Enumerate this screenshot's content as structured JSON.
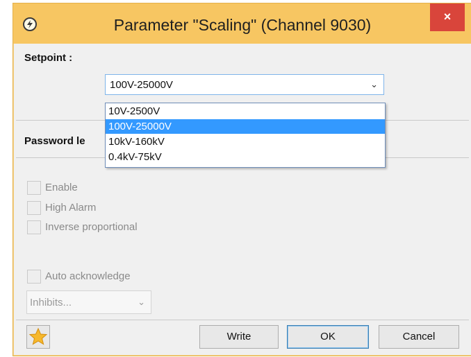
{
  "window": {
    "title": "Parameter \"Scaling\" (Channel 9030)",
    "close_glyph": "×"
  },
  "setpoint": {
    "label": "Setpoint :",
    "selected": "100V-25000V",
    "options": [
      "10V-2500V",
      "100V-25000V",
      "10kV-160kV",
      "0.4kV-75kV"
    ],
    "selected_index": 1
  },
  "password": {
    "label": "Password le"
  },
  "checkboxes": {
    "enable": "Enable",
    "high_alarm": "High Alarm",
    "inverse": "Inverse proportional",
    "auto_ack": "Auto acknowledge"
  },
  "inhibits": {
    "value": "Inhibits..."
  },
  "buttons": {
    "write": "Write",
    "ok": "OK",
    "cancel": "Cancel"
  },
  "colors": {
    "titlebar": "#f7c662",
    "close": "#d9453b",
    "selection": "#3399ff"
  }
}
